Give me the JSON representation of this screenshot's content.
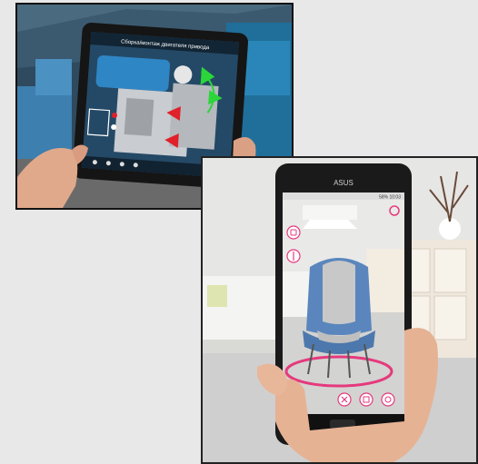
{
  "photos": [
    {
      "name": "industrial-ar-tablet-photo",
      "tablet": {
        "header_text": "Сборка/монтаж двигателя привода"
      }
    },
    {
      "name": "furniture-ar-phone-photo",
      "phone": {
        "brand": "ASUS",
        "status_bar": "58% 10:03"
      }
    }
  ]
}
